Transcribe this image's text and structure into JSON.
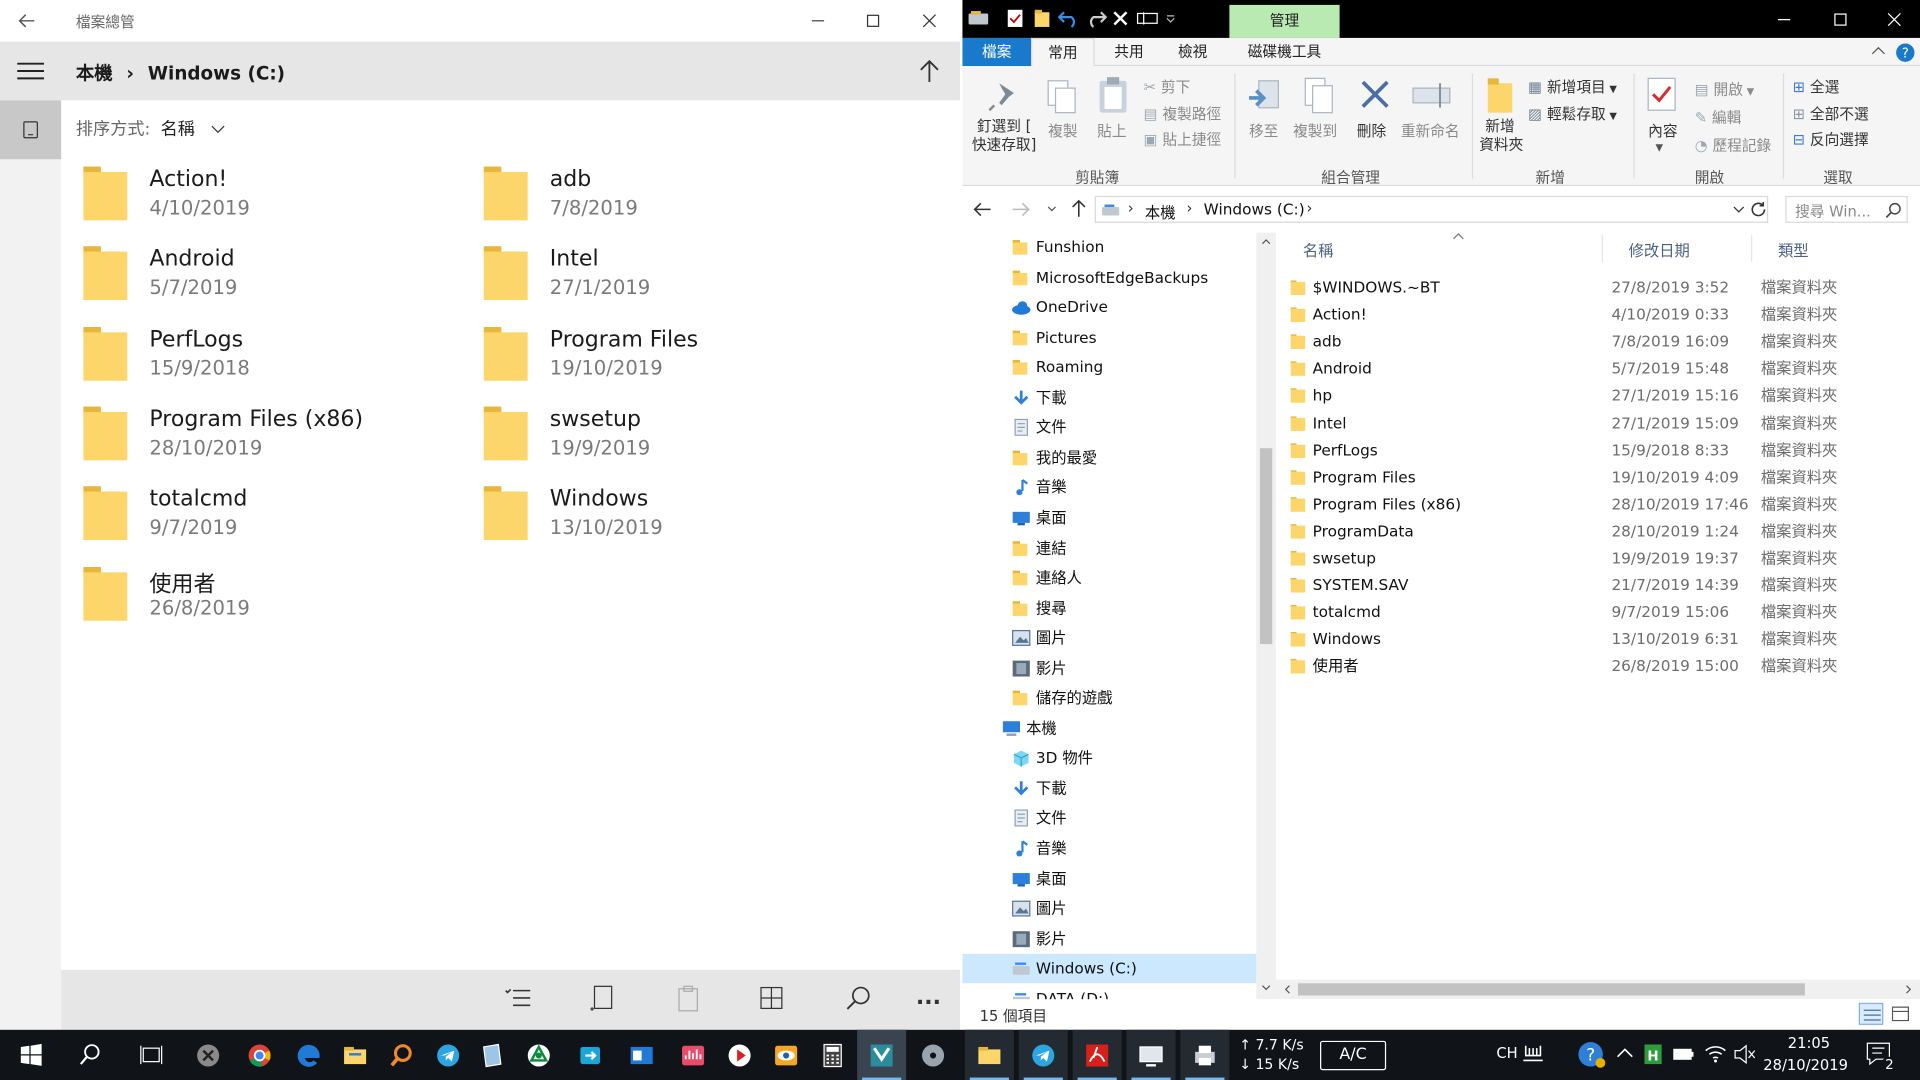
{
  "uwp": {
    "title": "檔案總管",
    "breadcrumb": {
      "root": "本機",
      "sep": "›",
      "current": "Windows (C:)"
    },
    "sort": {
      "label": "排序方式:",
      "value": "名稱"
    },
    "items": [
      {
        "name": "Action!",
        "date": "4/10/2019"
      },
      {
        "name": "adb",
        "date": "7/8/2019"
      },
      {
        "name": "Android",
        "date": "5/7/2019"
      },
      {
        "name": "Intel",
        "date": "27/1/2019"
      },
      {
        "name": "PerfLogs",
        "date": "15/9/2018"
      },
      {
        "name": "Program Files",
        "date": "19/10/2019"
      },
      {
        "name": "Program Files (x86)",
        "date": "28/10/2019"
      },
      {
        "name": "swsetup",
        "date": "19/9/2019"
      },
      {
        "name": "totalcmd",
        "date": "9/7/2019"
      },
      {
        "name": "Windows",
        "date": "13/10/2019"
      },
      {
        "name": "使用者",
        "date": "26/8/2019"
      }
    ],
    "cmd_more": "..."
  },
  "explorer": {
    "context_tab": "管理",
    "tabs": {
      "file": "檔案",
      "home": "常用",
      "share": "共用",
      "view": "檢視",
      "drive_tools": "磁碟機工具"
    },
    "ribbon": {
      "pin": [
        "釘選到 [",
        "快速存取]"
      ],
      "copy": "複製",
      "paste": "貼上",
      "cut": "剪下",
      "copy_path": "複製路徑",
      "paste_shortcut": "貼上捷徑",
      "group_clipboard": "剪貼簿",
      "move_to": "移至",
      "copy_to": "複製到",
      "delete": "刪除",
      "rename": "重新命名",
      "group_organize": "組合管理",
      "new_folder": [
        "新增",
        "資料夾"
      ],
      "new_item": "新增項目",
      "easy_access": "輕鬆存取",
      "group_new": "新增",
      "properties": "內容",
      "open": "開啟",
      "edit": "編輯",
      "history": "歷程記錄",
      "group_open": "開啟",
      "select_all": "全選",
      "select_none": "全部不選",
      "invert": "反向選擇",
      "group_select": "選取"
    },
    "address": {
      "pc": "本機",
      "sep": "›",
      "drive": "Windows (C:)"
    },
    "search_placeholder": "搜尋 Win...",
    "tree": [
      {
        "label": "Funshion",
        "icon": "folder"
      },
      {
        "label": "MicrosoftEdgeBackups",
        "icon": "folder"
      },
      {
        "label": "OneDrive",
        "icon": "cloud"
      },
      {
        "label": "Pictures",
        "icon": "folder"
      },
      {
        "label": "Roaming",
        "icon": "folder"
      },
      {
        "label": "下載",
        "icon": "download"
      },
      {
        "label": "文件",
        "icon": "document"
      },
      {
        "label": "我的最愛",
        "icon": "star-folder"
      },
      {
        "label": "音樂",
        "icon": "music"
      },
      {
        "label": "桌面",
        "icon": "desktop"
      },
      {
        "label": "連結",
        "icon": "link-folder"
      },
      {
        "label": "連絡人",
        "icon": "contacts-folder"
      },
      {
        "label": "搜尋",
        "icon": "search-folder"
      },
      {
        "label": "圖片",
        "icon": "pictures"
      },
      {
        "label": "影片",
        "icon": "videos"
      },
      {
        "label": "儲存的遊戲",
        "icon": "games-folder"
      },
      {
        "label": "本機",
        "icon": "pc"
      },
      {
        "label": "3D 物件",
        "icon": "3d"
      },
      {
        "label": "下載",
        "icon": "download"
      },
      {
        "label": "文件",
        "icon": "document"
      },
      {
        "label": "音樂",
        "icon": "music"
      },
      {
        "label": "桌面",
        "icon": "desktop"
      },
      {
        "label": "圖片",
        "icon": "pictures"
      },
      {
        "label": "影片",
        "icon": "videos"
      },
      {
        "label": "Windows (C:)",
        "icon": "drive"
      },
      {
        "label": "DATA (D:)",
        "icon": "drive"
      }
    ],
    "columns": {
      "name": "名稱",
      "date": "修改日期",
      "type": "類型"
    },
    "files": [
      {
        "name": "$WINDOWS.~BT",
        "date": "27/8/2019 3:52",
        "type": "檔案資料夾"
      },
      {
        "name": "Action!",
        "date": "4/10/2019 0:33",
        "type": "檔案資料夾"
      },
      {
        "name": "adb",
        "date": "7/8/2019 16:09",
        "type": "檔案資料夾"
      },
      {
        "name": "Android",
        "date": "5/7/2019 15:48",
        "type": "檔案資料夾"
      },
      {
        "name": "hp",
        "date": "27/1/2019 15:16",
        "type": "檔案資料夾"
      },
      {
        "name": "Intel",
        "date": "27/1/2019 15:09",
        "type": "檔案資料夾"
      },
      {
        "name": "PerfLogs",
        "date": "15/9/2018 8:33",
        "type": "檔案資料夾"
      },
      {
        "name": "Program Files",
        "date": "19/10/2019 4:09",
        "type": "檔案資料夾"
      },
      {
        "name": "Program Files (x86)",
        "date": "28/10/2019 17:46",
        "type": "檔案資料夾"
      },
      {
        "name": "ProgramData",
        "date": "28/10/2019 1:24",
        "type": "檔案資料夾"
      },
      {
        "name": "swsetup",
        "date": "19/9/2019 19:37",
        "type": "檔案資料夾"
      },
      {
        "name": "SYSTEM.SAV",
        "date": "21/7/2019 14:39",
        "type": "檔案資料夾"
      },
      {
        "name": "totalcmd",
        "date": "9/7/2019 15:06",
        "type": "檔案資料夾"
      },
      {
        "name": "Windows",
        "date": "13/10/2019 6:31",
        "type": "檔案資料夾"
      },
      {
        "name": "使用者",
        "date": "26/8/2019 15:00",
        "type": "檔案資料夾"
      }
    ],
    "status": "15 個項目"
  },
  "taskbar": {
    "net_up": "↑ 7.7 K/s",
    "net_down": "↓ 15 K/s",
    "ac": "A/C",
    "ime": "CH",
    "time": "21:05",
    "date": "28/10/2019",
    "notification_count": "2"
  },
  "colors": {
    "folder": "#fcd66a",
    "folder_dark": "#e8b53d",
    "accent": "#0078d7",
    "context_tab": "#b9eab1",
    "taskbar": "#101418"
  }
}
